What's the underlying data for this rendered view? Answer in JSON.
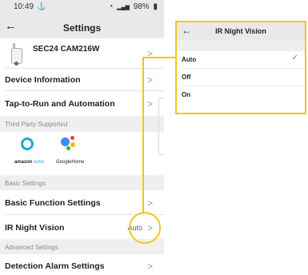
{
  "status_bar": {
    "time": "10:49",
    "left_icon": "ship-notification-icon",
    "left_glyph": "⚓",
    "wifi_glyph": "◔",
    "signal_glyph": "▂▄▆",
    "battery_text": "98%",
    "battery_glyph": "▮"
  },
  "nav": {
    "back_glyph": "←",
    "title": "Settings"
  },
  "device": {
    "name": "SEC24 CAM216W"
  },
  "rows": {
    "device_information": "Device Information",
    "tap_to_run": "Tap-to-Run and Automation",
    "basic_function": "Basic Function Settings",
    "ir_night_vision": "IR Night Vision",
    "ir_night_vision_value": "Auto",
    "detection_alarm": "Detection Alarm Settings"
  },
  "sections": {
    "third_party": "Third Party Supported",
    "basic": "Basic Settings",
    "advanced": "Advanced Settings"
  },
  "partners": {
    "echo_brand": "amazon",
    "echo_suffix": "echo",
    "google_home": "GoogleHome"
  },
  "chevron_glyph": ">",
  "popup": {
    "back_glyph": "←",
    "title": "IR Night Vision",
    "options": [
      {
        "label": "Auto",
        "selected": true
      },
      {
        "label": "Off",
        "selected": false
      },
      {
        "label": "On",
        "selected": false
      }
    ],
    "check_glyph": "✓"
  },
  "colors": {
    "highlight": "#f5c518",
    "check": "#4a7fd6",
    "echo_blue": "#1fa8d6"
  }
}
